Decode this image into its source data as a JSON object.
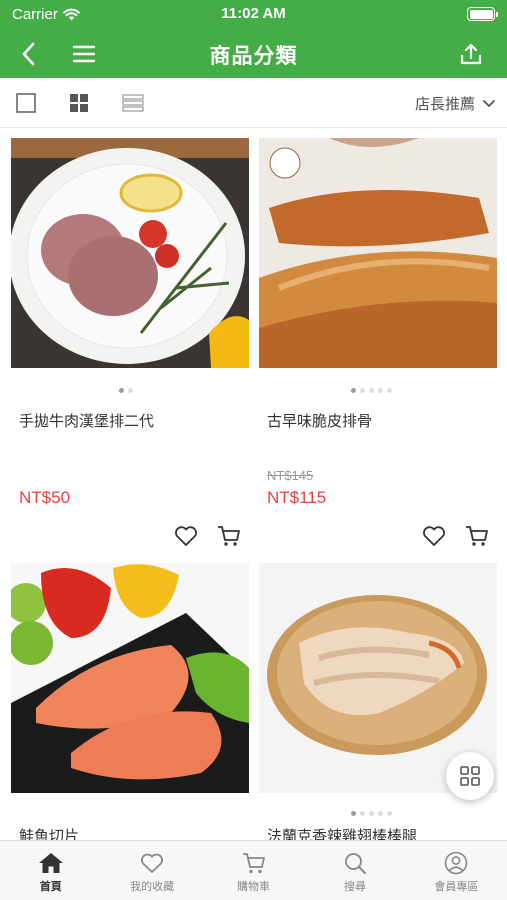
{
  "status_bar": {
    "carrier": "Carrier",
    "time": "11:02 AM",
    "battery_level": 1.0
  },
  "nav": {
    "title": "商品分類",
    "back_icon": "chevron-left-icon",
    "menu_icon": "hamburger-icon",
    "share_icon": "share-icon"
  },
  "toolbar": {
    "sort_label": "店長推薦",
    "view_modes": [
      "single-view-icon",
      "grid-view-icon",
      "list-view-icon"
    ],
    "active_view": "grid-view-icon"
  },
  "products": [
    {
      "name": "手拋牛肉漢堡排二代",
      "original_price": "",
      "price": "NT$50",
      "image_dots": 2,
      "active_dot": 0
    },
    {
      "name": "古早味脆皮排骨",
      "original_price": "NT$145",
      "price": "NT$115",
      "image_dots": 5,
      "active_dot": 0
    },
    {
      "name": "鮭魚切片",
      "original_price": "",
      "price": "",
      "image_dots": 0,
      "active_dot": 0
    },
    {
      "name": "法蘭克香辣雞翅棒棒腿",
      "original_price": "",
      "price": "",
      "image_dots": 5,
      "active_dot": 0
    }
  ],
  "tabs": [
    {
      "label": "首頁",
      "icon": "home-icon",
      "active": true
    },
    {
      "label": "我的收藏",
      "icon": "heart-icon",
      "active": false
    },
    {
      "label": "購物車",
      "icon": "cart-icon",
      "active": false
    },
    {
      "label": "搜尋",
      "icon": "search-icon",
      "active": false
    },
    {
      "label": "會員專區",
      "icon": "user-icon",
      "active": false
    }
  ],
  "colors": {
    "brand_green": "#45ad47",
    "price_red": "#ef3f43",
    "strike_gray": "#999999"
  }
}
